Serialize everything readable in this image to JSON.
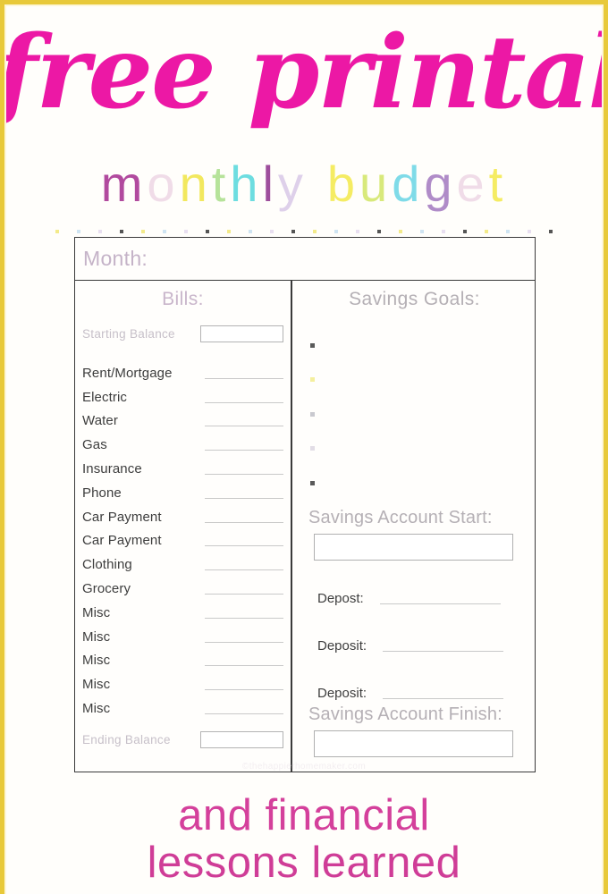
{
  "colors": {
    "frame": "#e8c93a",
    "headline_pink": "#ec18a5",
    "footer_pink": "#d4409b",
    "label_mauve": "#c5b3c8",
    "ink": "#3d3d3d"
  },
  "headline": {
    "text": "free printable"
  },
  "subtitle": {
    "word1": "monthly",
    "word2": "budget",
    "letters": [
      {
        "char": "m",
        "color": "#b14a9e"
      },
      {
        "char": "o",
        "color": "#f0dce8"
      },
      {
        "char": "n",
        "color": "#f2e85e"
      },
      {
        "char": "t",
        "color": "#b6e39a"
      },
      {
        "char": "h",
        "color": "#6ddde0"
      },
      {
        "char": "l",
        "color": "#9e4e9c"
      },
      {
        "char": "y",
        "color": "#ded0ea"
      },
      {
        "char": "b",
        "color": "#f5ec63"
      },
      {
        "char": "u",
        "color": "#d8e97b"
      },
      {
        "char": "d",
        "color": "#7fdbe8"
      },
      {
        "char": "g",
        "color": "#b08cc8"
      },
      {
        "char": "e",
        "color": "#f0dce8"
      },
      {
        "char": "t",
        "color": "#f5ec63"
      }
    ]
  },
  "dot_rule": {
    "colors": [
      "#f3ea8a",
      "#cfe4f2",
      "#e8dff0",
      "#555555",
      "#f3ea8a",
      "#cfe4f2",
      "#e8dff0",
      "#555555",
      "#f3ea8a",
      "#cfe4f2",
      "#e8dff0",
      "#555555",
      "#f3ea8a",
      "#cfe4f2",
      "#e8dff0",
      "#555555",
      "#f3ea8a",
      "#cfe4f2",
      "#e8dff0",
      "#555555",
      "#f3ea8a",
      "#cfe4f2",
      "#e8dff0",
      "#555555"
    ]
  },
  "form": {
    "month_label": "Month:",
    "month_value": "",
    "bills": {
      "heading": "Bills:",
      "starting_balance_label": "Starting Balance",
      "starting_balance_value": "",
      "ending_balance_label": "Ending Balance",
      "ending_balance_value": "",
      "items": [
        {
          "label": "Rent/Mortgage",
          "value": ""
        },
        {
          "label": "Electric",
          "value": ""
        },
        {
          "label": "Water",
          "value": ""
        },
        {
          "label": "Gas",
          "value": ""
        },
        {
          "label": "Insurance",
          "value": ""
        },
        {
          "label": "Phone",
          "value": ""
        },
        {
          "label": "Car Payment",
          "value": ""
        },
        {
          "label": "Car Payment",
          "value": ""
        },
        {
          "label": "Clothing",
          "value": ""
        },
        {
          "label": "Grocery",
          "value": ""
        },
        {
          "label": "Misc",
          "value": ""
        },
        {
          "label": "Misc",
          "value": ""
        },
        {
          "label": "Misc",
          "value": ""
        },
        {
          "label": "Misc",
          "value": ""
        },
        {
          "label": "Misc",
          "value": ""
        }
      ]
    },
    "savings": {
      "heading": "Savings Goals:",
      "goal_bullets": [
        {
          "color": "#5a5a5a"
        },
        {
          "color": "#f4ef9e"
        },
        {
          "color": "#c9c9cf"
        },
        {
          "color": "#e2dde6"
        },
        {
          "color": "#5a5a5a"
        }
      ],
      "account_start_label": "Savings Account Start:",
      "account_start_value": "",
      "deposits": [
        {
          "label": "Depost:",
          "value": ""
        },
        {
          "label": "Deposit:",
          "value": ""
        },
        {
          "label": "Deposit:",
          "value": ""
        }
      ],
      "account_finish_label": "Savings Account Finish:",
      "account_finish_value": ""
    }
  },
  "watermark": {
    "text": "©thehappierhomemaker.com"
  },
  "footer": {
    "line1": "and financial",
    "line2": "lessons learned"
  }
}
